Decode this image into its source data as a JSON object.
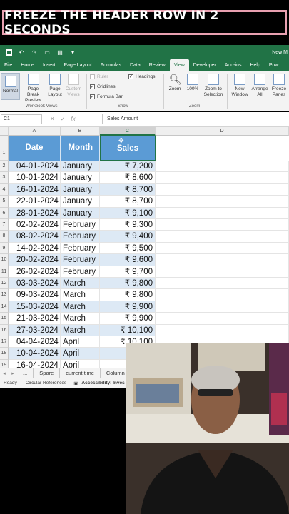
{
  "banner": {
    "text": "FREEZE THE HEADER ROW IN 2 SECONDS"
  },
  "titlebar": {
    "text": "New M"
  },
  "tabs": [
    "File",
    "Home",
    "Insert",
    "Page Layout",
    "Formulas",
    "Data",
    "Review",
    "View",
    "Developer",
    "Add-ins",
    "Help",
    "Pow"
  ],
  "active_tab": "View",
  "ribbon": {
    "normal": "Normal",
    "page_break": "Page Break Preview",
    "page_layout": "Page Layout",
    "custom_views": "Custom Views",
    "workbook_views_label": "Workbook Views",
    "ruler": "Ruler",
    "gridlines": "Gridlines",
    "formula_bar": "Formula Bar",
    "headings": "Headings",
    "show_label": "Show",
    "zoom": "Zoom",
    "zoom100": "100%",
    "zoom_selection": "Zoom to Selection",
    "zoom_label": "Zoom",
    "new_window": "New Window",
    "arrange_all": "Arrange All",
    "freeze_panes": "Freeze Panes"
  },
  "formula_bar": {
    "name_box": "C1",
    "content": "Sales Amount",
    "fx": "fx"
  },
  "columns": [
    "A",
    "B",
    "C",
    "D"
  ],
  "headers": {
    "date": "Date",
    "month": "Month",
    "sales": "Sales Amount"
  },
  "rows": [
    {
      "n": "2",
      "date": "04-01-2024",
      "month": "January",
      "amount": "₹ 7,200"
    },
    {
      "n": "3",
      "date": "10-01-2024",
      "month": "January",
      "amount": "₹ 8,600"
    },
    {
      "n": "4",
      "date": "16-01-2024",
      "month": "January",
      "amount": "₹ 8,700"
    },
    {
      "n": "5",
      "date": "22-01-2024",
      "month": "January",
      "amount": "₹ 8,700"
    },
    {
      "n": "6",
      "date": "28-01-2024",
      "month": "January",
      "amount": "₹ 9,100"
    },
    {
      "n": "7",
      "date": "02-02-2024",
      "month": "February",
      "amount": "₹ 9,300"
    },
    {
      "n": "8",
      "date": "08-02-2024",
      "month": "February",
      "amount": "₹ 9,400"
    },
    {
      "n": "9",
      "date": "14-02-2024",
      "month": "February",
      "amount": "₹ 9,500"
    },
    {
      "n": "10",
      "date": "20-02-2024",
      "month": "February",
      "amount": "₹ 9,600"
    },
    {
      "n": "11",
      "date": "26-02-2024",
      "month": "February",
      "amount": "₹ 9,700"
    },
    {
      "n": "12",
      "date": "03-03-2024",
      "month": "March",
      "amount": "₹ 9,800"
    },
    {
      "n": "13",
      "date": "09-03-2024",
      "month": "March",
      "amount": "₹ 9,800"
    },
    {
      "n": "14",
      "date": "15-03-2024",
      "month": "March",
      "amount": "₹ 9,900"
    },
    {
      "n": "15",
      "date": "21-03-2024",
      "month": "March",
      "amount": "₹ 9,900"
    },
    {
      "n": "16",
      "date": "27-03-2024",
      "month": "March",
      "amount": "₹ 10,100"
    },
    {
      "n": "17",
      "date": "04-04-2024",
      "month": "April",
      "amount": "₹ 10,100"
    },
    {
      "n": "18",
      "date": "10-04-2024",
      "month": "April",
      "amount": "₹"
    },
    {
      "n": "19",
      "date": "16-04-2024",
      "month": "April",
      "amount": "₹"
    }
  ],
  "sheet_tabs": [
    "...",
    "Spare",
    "current time",
    "Column"
  ],
  "status": {
    "ready": "Ready",
    "circular": "Circular References",
    "accessibility": "Accessibility: Inves"
  },
  "colors": {
    "excel_green": "#217346",
    "header_blue": "#5b9bd5",
    "band_blue": "#dde9f5"
  }
}
